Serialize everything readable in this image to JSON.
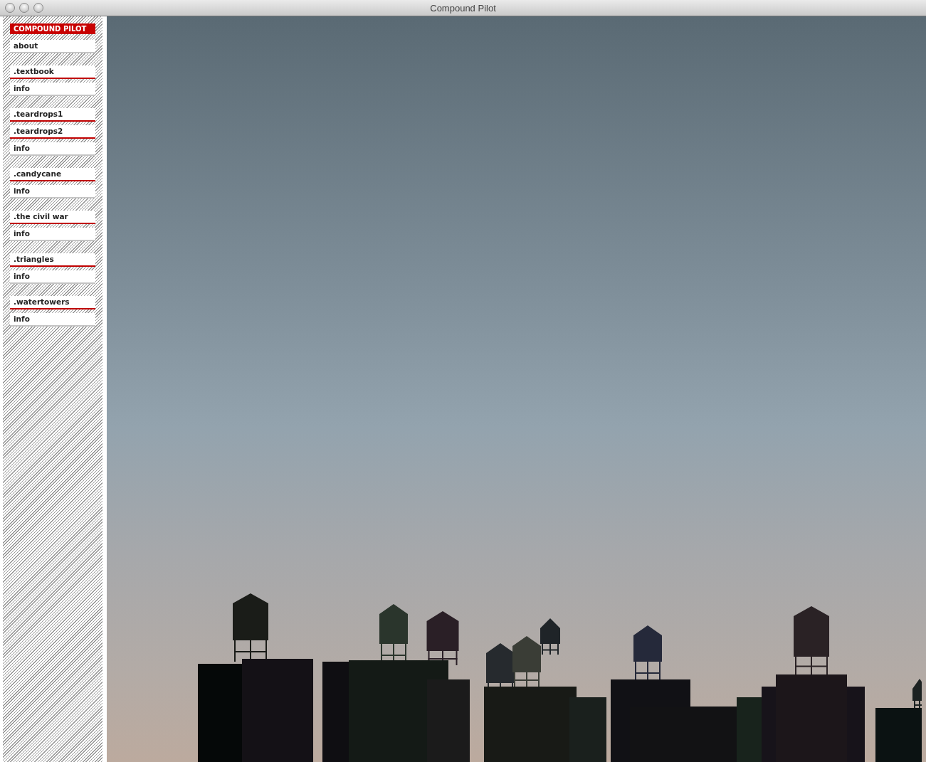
{
  "window": {
    "title": "Compound Pilot"
  },
  "sidebar": {
    "brand": "COMPOUND PILOT",
    "about": "about",
    "groups": [
      {
        "projects": [
          ".textbook"
        ],
        "info": "info"
      },
      {
        "projects": [
          ".teardrops1",
          ".teardrops2"
        ],
        "info": "info"
      },
      {
        "projects": [
          ".candycane"
        ],
        "info": "info"
      },
      {
        "projects": [
          ".the civil war"
        ],
        "info": "info"
      },
      {
        "projects": [
          ".triangles"
        ],
        "info": "info"
      },
      {
        "projects": [
          ".watertowers"
        ],
        "info": "info"
      }
    ]
  }
}
